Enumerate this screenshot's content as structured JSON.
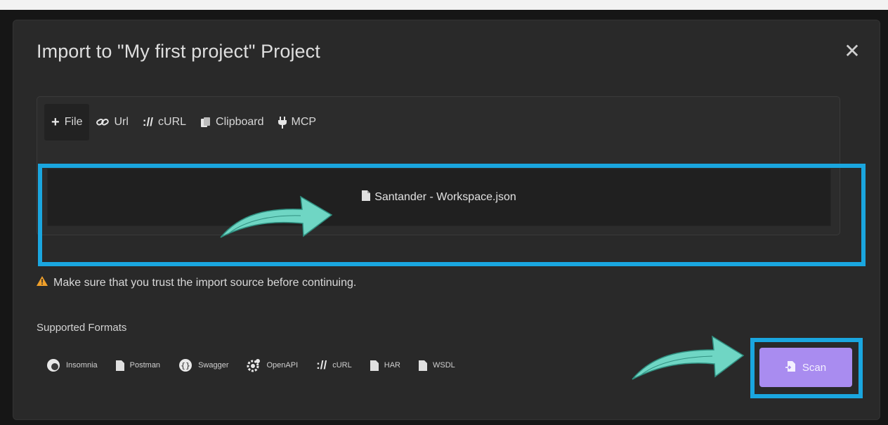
{
  "modal": {
    "title": "Import to \"My first project\" Project",
    "close_icon": "close-icon"
  },
  "tabs": [
    {
      "label": "File",
      "icon": "plus-icon",
      "active": true
    },
    {
      "label": "Url",
      "icon": "link-icon",
      "active": false
    },
    {
      "label": "cURL",
      "icon": "curl-icon",
      "active": false
    },
    {
      "label": "Clipboard",
      "icon": "clipboard-icon",
      "active": false
    },
    {
      "label": "MCP",
      "icon": "plug-icon",
      "active": false
    }
  ],
  "dropzone": {
    "file_name": "Santander - Workspace.json",
    "icon": "file-icon"
  },
  "warning": {
    "text": "Make sure that you trust the import source before continuing.",
    "icon": "warning-icon",
    "color": "#f0a02a"
  },
  "supported_formats": {
    "title": "Supported Formats",
    "items": [
      {
        "label": "Insomnia",
        "icon": "insomnia-icon"
      },
      {
        "label": "Postman",
        "icon": "postman-icon"
      },
      {
        "label": "Swagger",
        "icon": "swagger-icon"
      },
      {
        "label": "OpenAPI",
        "icon": "openapi-icon"
      },
      {
        "label": "cURL",
        "icon": "curl-icon"
      },
      {
        "label": "HAR",
        "icon": "har-icon"
      },
      {
        "label": "WSDL",
        "icon": "wsdl-icon"
      }
    ]
  },
  "scan_button": {
    "label": "Scan",
    "icon": "scan-icon",
    "color": "#a98cf0"
  },
  "colors": {
    "highlight": "#1aa6df",
    "arrow": "#6fd6c4",
    "modal_bg": "#292929"
  }
}
